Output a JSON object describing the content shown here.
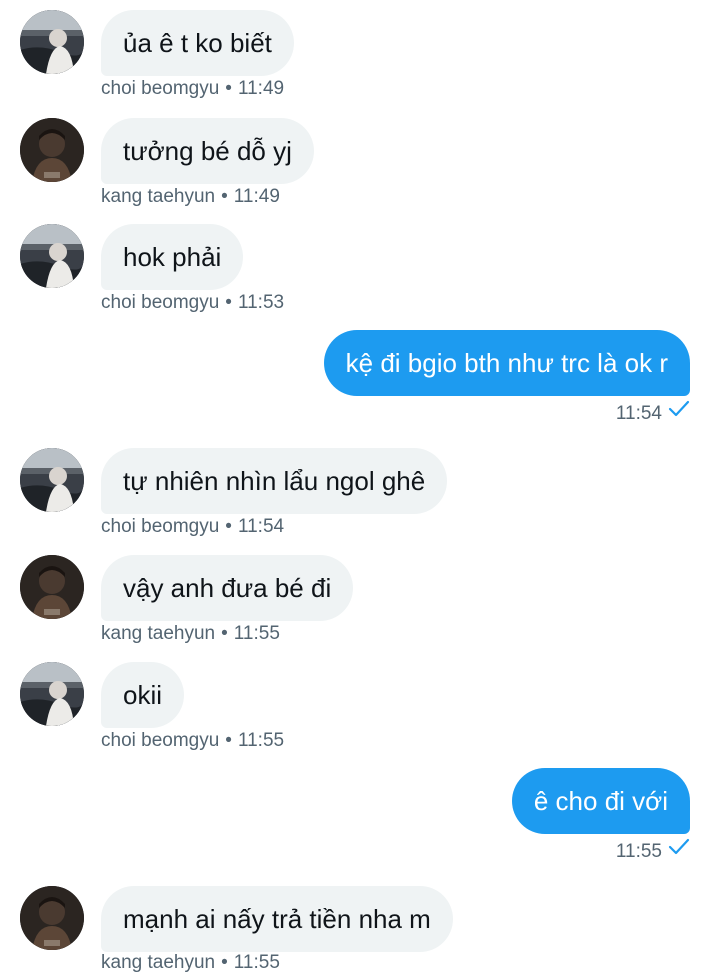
{
  "conversation": {
    "messages": [
      {
        "side": "in",
        "avatar": "choi",
        "text": "ủa ê t ko biết",
        "sender": "choi beomgyu",
        "time": "11:49"
      },
      {
        "side": "in",
        "avatar": "kang",
        "text": "tưởng bé dỗ yj",
        "sender": "kang taehyun",
        "time": "11:49"
      },
      {
        "side": "in",
        "avatar": "choi",
        "text": "hok phải",
        "sender": "choi beomgyu",
        "time": "11:53"
      },
      {
        "side": "out",
        "text": "kệ đi bgio bth như trc là ok r",
        "time": "11:54"
      },
      {
        "side": "in",
        "avatar": "choi",
        "text": "tự nhiên nhìn lẩu ngol ghê",
        "sender": "choi beomgyu",
        "time": "11:54"
      },
      {
        "side": "in",
        "avatar": "kang",
        "text": "vậy anh đưa bé đi",
        "sender": "kang taehyun",
        "time": "11:55"
      },
      {
        "side": "in",
        "avatar": "choi",
        "text": "okii",
        "sender": "choi beomgyu",
        "time": "11:55"
      },
      {
        "side": "out",
        "text": "ê cho đi với",
        "time": "11:55"
      },
      {
        "side": "in",
        "avatar": "kang",
        "text": "mạnh ai nấy trả tiền nha m",
        "sender": "kang taehyun",
        "time": "11:55"
      }
    ],
    "separator": "•",
    "read_icon": "check-icon",
    "colors": {
      "outgoing_bubble": "#1d9bf0",
      "incoming_bubble": "#eff3f4",
      "meta_text": "#536471"
    }
  }
}
